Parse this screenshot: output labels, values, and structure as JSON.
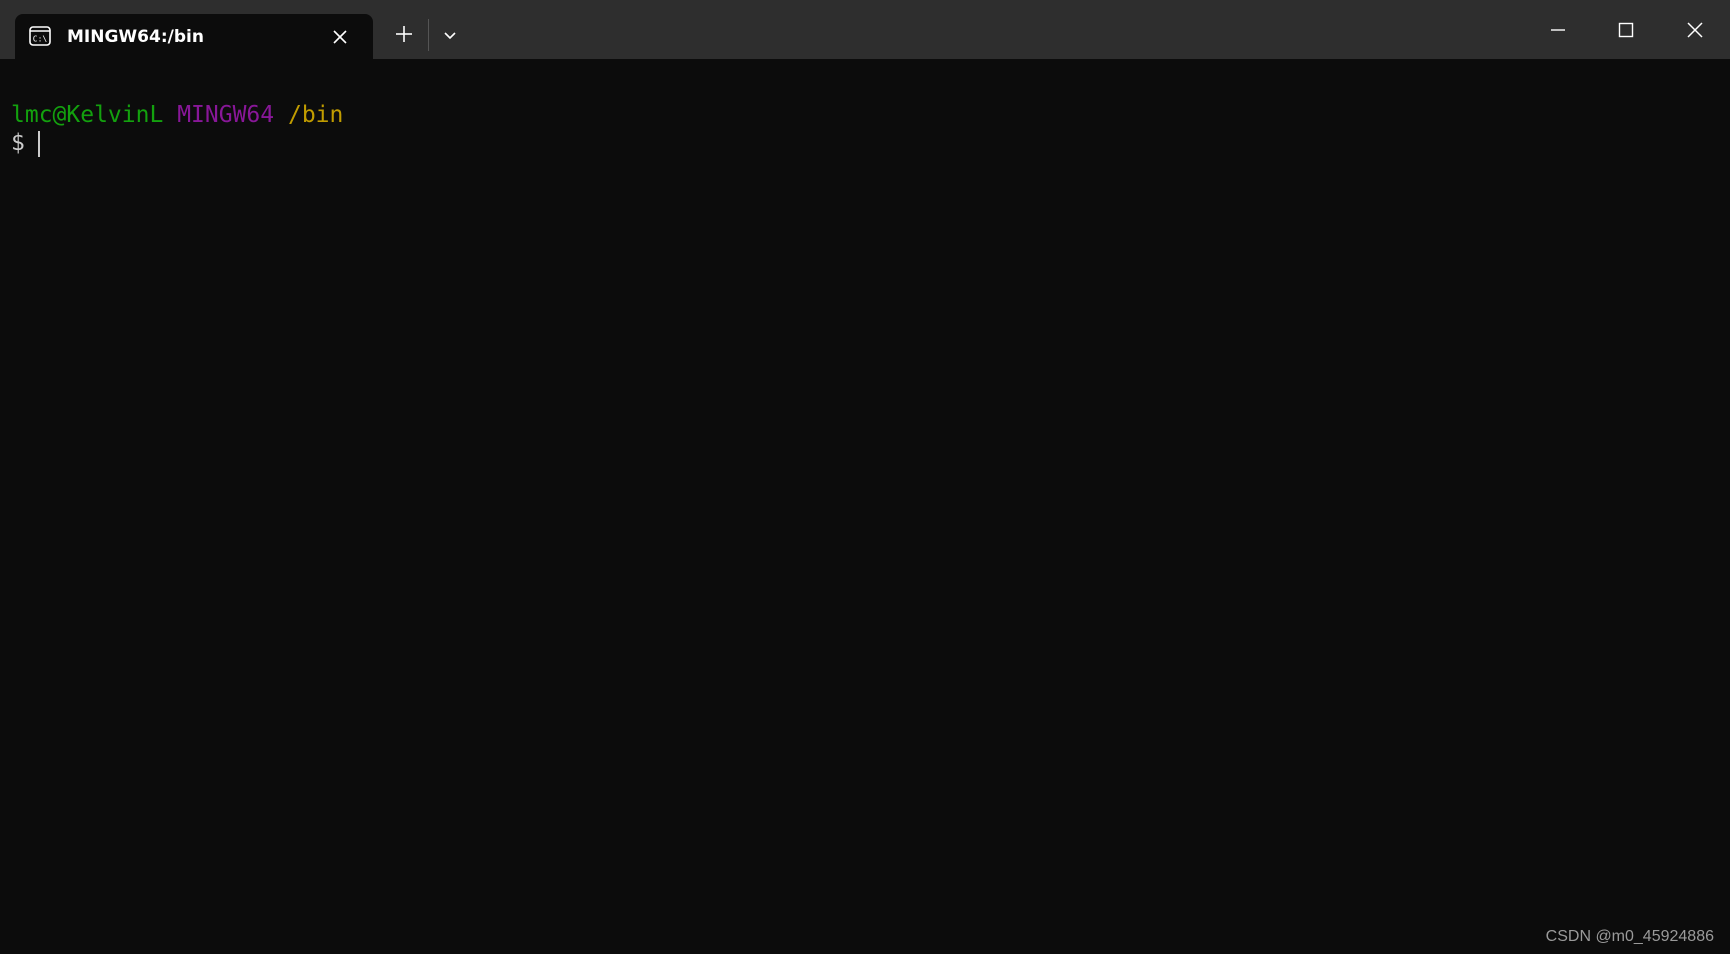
{
  "window": {
    "title": "MINGW64:/bin"
  },
  "tab": {
    "icon": "terminal-icon",
    "title": "MINGW64:/bin"
  },
  "titlebar": {
    "new_tab_icon": "plus-icon",
    "dropdown_icon": "chevron-down-icon",
    "minimize_icon": "minimize-icon",
    "maximize_icon": "maximize-icon",
    "close_icon": "close-icon"
  },
  "terminal": {
    "prompt_user": "lmc@KelvinL",
    "prompt_system": "MINGW64",
    "prompt_path": "/bin",
    "prompt_symbol": "$",
    "colors": {
      "background": "#0c0c0c",
      "user": "#13a10e",
      "system": "#881798",
      "path": "#c19c00",
      "text": "#cccccc"
    }
  },
  "watermark": "CSDN @m0_45924886"
}
